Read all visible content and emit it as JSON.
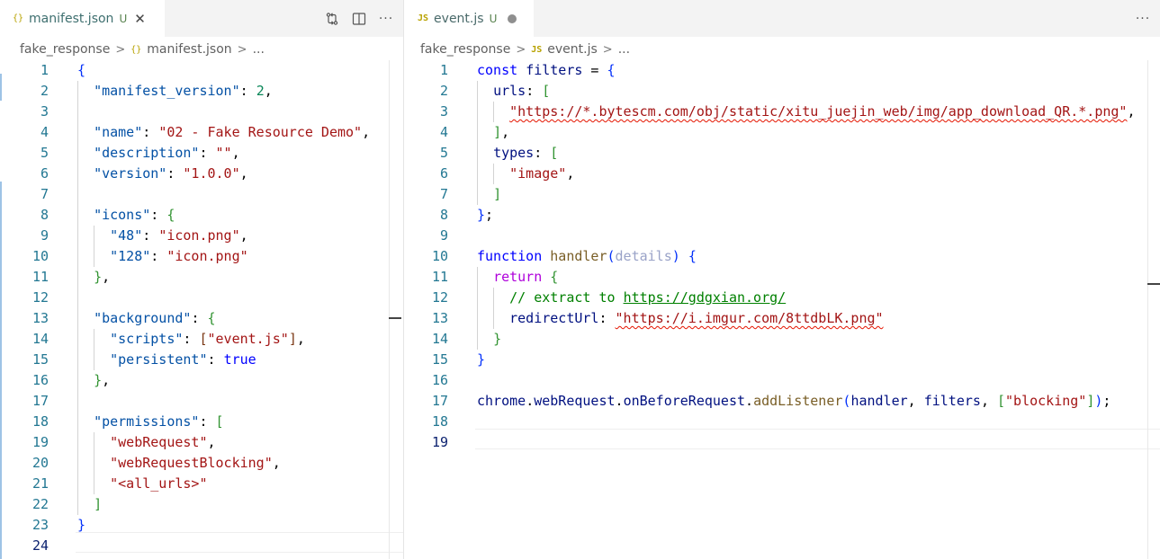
{
  "left_editor": {
    "tab": {
      "label": "manifest.json",
      "status": "U",
      "close": "✕",
      "icon_text": "{}"
    },
    "breadcrumb": {
      "folder": "fake_response",
      "file": "manifest.json",
      "more": "..."
    },
    "lines": [
      "1",
      "2",
      "3",
      "4",
      "5",
      "6",
      "7",
      "8",
      "9",
      "10",
      "11",
      "12",
      "13",
      "14",
      "15",
      "16",
      "17",
      "18",
      "19",
      "20",
      "21",
      "22",
      "23",
      "24"
    ],
    "code": {
      "l1_brace": "{",
      "l2_key": "\"manifest_version\"",
      "l2_colon": ": ",
      "l2_val": "2",
      "l2_end": ",",
      "l4_key": "\"name\"",
      "l4_colon": ": ",
      "l4_val": "\"02 - Fake Resource Demo\"",
      "l4_end": ",",
      "l5_key": "\"description\"",
      "l5_colon": ": ",
      "l5_val": "\"\"",
      "l5_end": ",",
      "l6_key": "\"version\"",
      "l6_colon": ": ",
      "l6_val": "\"1.0.0\"",
      "l6_end": ",",
      "l8_key": "\"icons\"",
      "l8_colon": ": ",
      "l8_open": "{",
      "l9_key": "\"48\"",
      "l9_colon": ": ",
      "l9_val": "\"icon.png\"",
      "l9_end": ",",
      "l10_key": "\"128\"",
      "l10_colon": ": ",
      "l10_val": "\"icon.png\"",
      "l11_close": "}",
      "l11_end": ",",
      "l13_key": "\"background\"",
      "l13_colon": ": ",
      "l13_open": "{",
      "l14_key": "\"scripts\"",
      "l14_colon": ": ",
      "l14_open": "[",
      "l14_val": "\"event.js\"",
      "l14_close": "]",
      "l14_end": ",",
      "l15_key": "\"persistent\"",
      "l15_colon": ": ",
      "l15_val": "true",
      "l16_close": "}",
      "l16_end": ",",
      "l18_key": "\"permissions\"",
      "l18_colon": ": ",
      "l18_open": "[",
      "l19_val": "\"webRequest\"",
      "l19_end": ",",
      "l20_val": "\"webRequestBlocking\"",
      "l20_end": ",",
      "l21_val": "\"<all_urls>\"",
      "l22_close": "]",
      "l23_brace": "}"
    }
  },
  "right_editor": {
    "tab": {
      "label": "event.js",
      "status": "U",
      "icon_text": "JS"
    },
    "breadcrumb": {
      "folder": "fake_response",
      "file": "event.js",
      "more": "..."
    },
    "lines": [
      "1",
      "2",
      "3",
      "4",
      "5",
      "6",
      "7",
      "8",
      "9",
      "10",
      "11",
      "12",
      "13",
      "14",
      "15",
      "16",
      "17",
      "18",
      "19"
    ],
    "code": {
      "l1_kw": "const",
      "l1_var": "filters",
      "l1_eq": " = ",
      "l1_open": "{",
      "l2_key": "urls",
      "l2_colon": ": ",
      "l2_open": "[",
      "l3_val": "\"https://*.bytescm.com/obj/static/xitu_juejin_web/img/app_download_QR.*.png\"",
      "l3_end": ",",
      "l4_close": "]",
      "l4_end": ",",
      "l5_key": "types",
      "l5_colon": ": ",
      "l5_open": "[",
      "l6_val": "\"image\"",
      "l6_end": ",",
      "l7_close": "]",
      "l8_close": "}",
      "l8_end": ";",
      "l10_kw": "function",
      "l10_fn": "handler",
      "l10_open": "(",
      "l10_param": "details",
      "l10_close": ")",
      "l10_brace": "{",
      "l11_kw": "return",
      "l11_open": "{",
      "l12_comment": "// extract to ",
      "l12_link": "https://gdgxian.org/",
      "l13_key": "redirectUrl",
      "l13_colon": ": ",
      "l13_val": "\"https://i.imgur.com/8ttdbLK.png\"",
      "l14_close": "}",
      "l15_close": "}",
      "l17_obj": "chrome",
      "l17_dot1": ".",
      "l17_prop": "webRequest",
      "l17_dot2": ".",
      "l17_evt": "onBeforeRequest",
      "l17_dot3": ".",
      "l17_fn": "addListener",
      "l17_open": "(",
      "l17_arg1": "handler",
      "l17_comma1": ", ",
      "l17_arg2": "filters",
      "l17_comma2": ", ",
      "l17_arr_open": "[",
      "l17_arr_val": "\"blocking\"",
      "l17_arr_close": "]",
      "l17_close": ")",
      "l17_end": ";"
    }
  },
  "icons": {
    "compare": "git-compare-icon",
    "split": "split-editor-icon",
    "more": "more-actions-icon"
  },
  "colors": {
    "keyword": "#0000ff",
    "string": "#a31515",
    "property": "#0451a5",
    "number": "#098658",
    "function": "#795e26",
    "variable": "#001080",
    "comment": "#008000",
    "line_number": "#237893"
  }
}
